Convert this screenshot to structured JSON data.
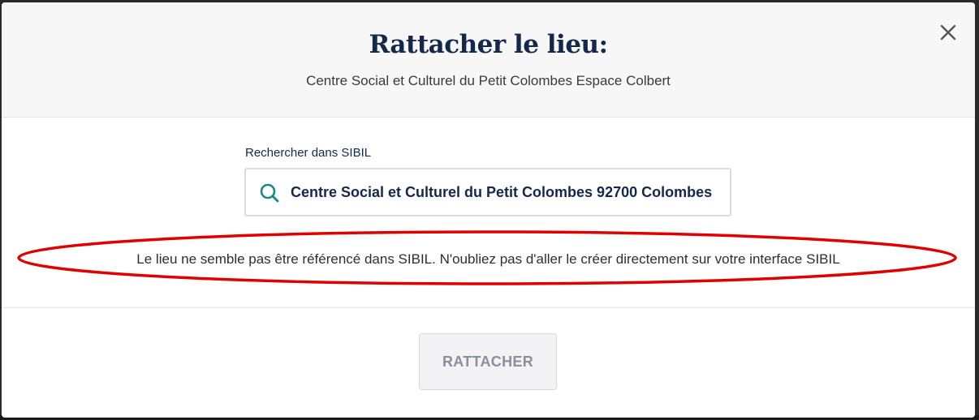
{
  "modal": {
    "title": "Rattacher le lieu:",
    "subtitle": "Centre Social et Culturel du Petit Colombes Espace Colbert",
    "close_icon": "close-icon"
  },
  "search": {
    "label": "Rechercher dans SIBIL",
    "value": "Centre Social et Culturel du Petit Colombes 92700 Colombes",
    "icon": "search-icon",
    "icon_color": "#1a8a8a"
  },
  "warning": {
    "text": "Le lieu ne semble pas être référencé dans SIBIL. N'oubliez pas d'aller le créer directement sur votre interface SIBIL",
    "highlight_color": "#e00000"
  },
  "footer": {
    "attach_label": "RATTACHER"
  },
  "colors": {
    "title": "#14284b",
    "header_bg": "#f7f7f7",
    "button_disabled_text": "#8a8f9c"
  }
}
